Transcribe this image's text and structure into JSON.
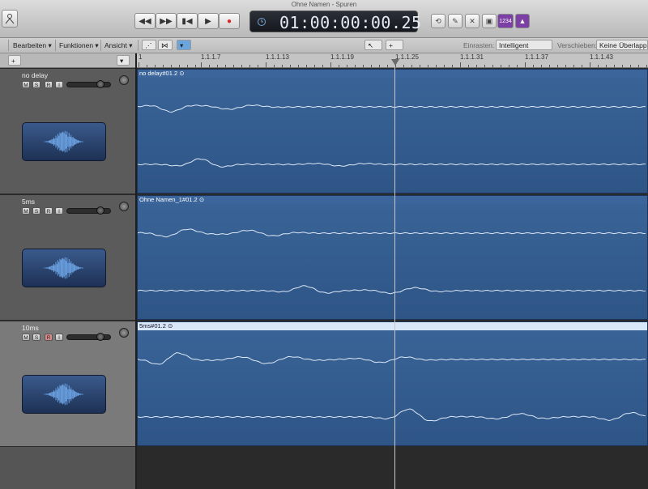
{
  "window": {
    "title": "Ohne Namen - Spuren"
  },
  "transport": {
    "rewind": "◀◀",
    "forward": "▶▶",
    "to_start": "▮◀",
    "play": "▶",
    "record": "●",
    "time": "01:00:00:00.25",
    "counter": "1234"
  },
  "menubar": {
    "edit": "Bearbeiten ▾",
    "functions": "Funktionen ▾",
    "view": "Ansicht ▾",
    "snap_label": "Einrasten:",
    "snap_value": "Intelligent",
    "drag_label": "Verschieben:",
    "drag_value": "Keine Überlappung"
  },
  "ruler": {
    "ticks": [
      "1",
      "1.1.1.7",
      "1.1.1.13",
      "1.1.1.19",
      "1.1.1.25",
      "1.1.1.31",
      "1.1.1.37",
      "1.1.1.43"
    ]
  },
  "tracks": [
    {
      "name": "no delay",
      "region": "no delay#01.2",
      "selected": false
    },
    {
      "name": "5ms",
      "region": "Ohne Namen_1#01.2",
      "selected": false
    },
    {
      "name": "10ms",
      "region": "5ms#01.2",
      "selected": true
    }
  ],
  "track_buttons": {
    "mute": "M",
    "solo": "S",
    "record": "R",
    "input": "I"
  },
  "icons": {
    "library": "library-icon",
    "add_track": "add-track-icon",
    "cycle": "cycle-icon",
    "tuner": "tuner-icon",
    "metronome": "metronome-icon",
    "playhead": "playhead-icon"
  },
  "colors": {
    "region": "#2e5586",
    "region_selected_bar": "#d8e8f8",
    "waveform": "#dce8f6",
    "counter": "#7b3fa6"
  }
}
